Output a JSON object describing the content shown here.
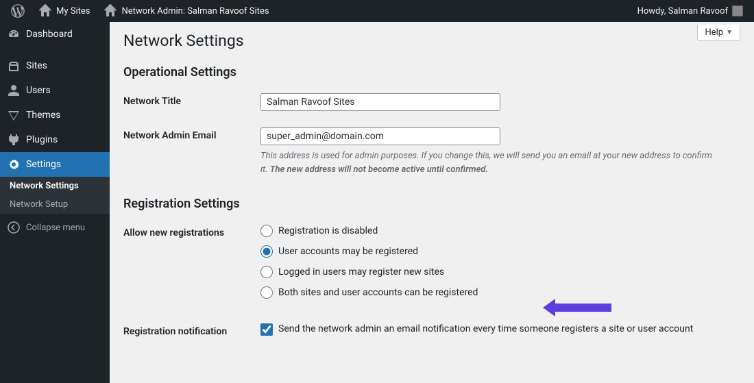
{
  "adminbar": {
    "my_sites": "My Sites",
    "site_title": "Network Admin: Salman Ravoof Sites",
    "howdy": "Howdy, Salman Ravoof"
  },
  "sidebar": {
    "dashboard": "Dashboard",
    "sites": "Sites",
    "users": "Users",
    "themes": "Themes",
    "plugins": "Plugins",
    "settings": "Settings",
    "network_settings": "Network Settings",
    "network_setup": "Network Setup",
    "collapse": "Collapse menu"
  },
  "help": "Help",
  "page": {
    "title": "Network Settings",
    "operational_heading": "Operational Settings",
    "network_title_label": "Network Title",
    "network_title_value": "Salman Ravoof Sites",
    "admin_email_label": "Network Admin Email",
    "admin_email_value": "super_admin@domain.com",
    "admin_email_desc1": "This address is used for admin purposes. If you change this, we will send you an email at your new address to confirm it. ",
    "admin_email_desc2": "The new address will not become active until confirmed.",
    "registration_heading": "Registration Settings",
    "allow_reg_label": "Allow new registrations",
    "reg_options": {
      "none": "Registration is disabled",
      "user": "User accounts may be registered",
      "blog": "Logged in users may register new sites",
      "all": "Both sites and user accounts can be registered"
    },
    "reg_notify_label": "Registration notification",
    "reg_notify_text": "Send the network admin an email notification every time someone registers a site or user account"
  }
}
